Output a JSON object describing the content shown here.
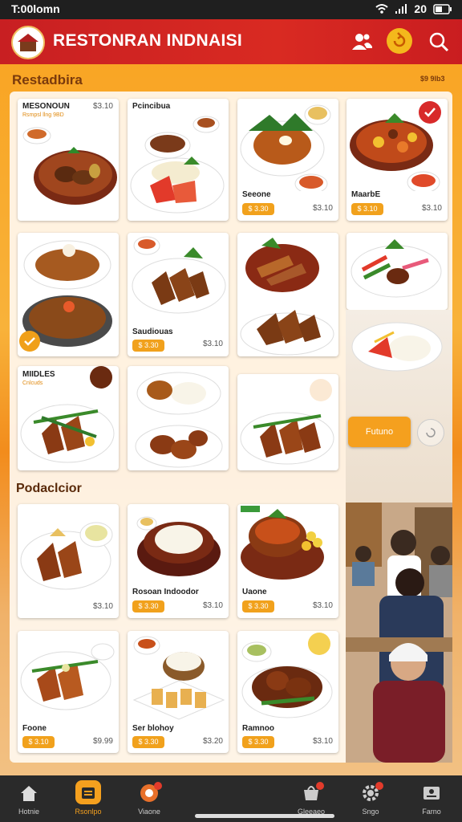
{
  "status_bar": {
    "time": "T:00lomn",
    "battery": "20"
  },
  "app_bar": {
    "title": "RESTONRAN INDNAISI"
  },
  "section1": {
    "title": "Restadbira",
    "right_text": "$9 9lb3"
  },
  "section2": {
    "title": "Podaclcior"
  },
  "cards_row1": [
    {
      "name": "MESONOUN",
      "subtitle": "Rsmpsl llng 9BD",
      "price": "$3.10"
    },
    {
      "name": "Pcincibua",
      "price": ""
    },
    {
      "name": "Seeone",
      "button": "$ 3.30",
      "price": "$3.10"
    },
    {
      "name": "MaarbE",
      "button": "$ 3.10",
      "price": "$3.10"
    }
  ],
  "cards_row2": [
    {
      "name": "",
      "price": ""
    },
    {
      "name": "Saudiouas",
      "button": "$ 3.30",
      "price": "$3.10"
    },
    {
      "name": "",
      "price": ""
    }
  ],
  "cards_row3": [
    {
      "name": "MIIDLES",
      "subtitle": "Cnlcuds"
    },
    {
      "name": ""
    },
    {
      "name": ""
    }
  ],
  "cards_row4": [
    {
      "name": "",
      "price": "$3.10"
    },
    {
      "name": "Rosoan Indoodor",
      "button": "$ 3.30",
      "price": "$3.10"
    },
    {
      "name": "Uaone",
      "button": "$ 3.30",
      "price": "$3.10"
    }
  ],
  "cards_row5": [
    {
      "name": "Foone",
      "button": "$ 3.10",
      "price": "$9.99"
    },
    {
      "name": "Ser blohoy",
      "button": "$ 3.30",
      "price": "$3.20"
    },
    {
      "name": "Ramnoo",
      "button": "$ 3.30",
      "price": "$3.10"
    }
  ],
  "promo": {
    "button_label": "Futuno"
  },
  "bottom_nav": [
    {
      "label": "Hotnie"
    },
    {
      "label": "Rsonlpo"
    },
    {
      "label": "Viaone"
    },
    {
      "label": "Gleeaeo"
    },
    {
      "label": "Sngo"
    },
    {
      "label": "Farno"
    }
  ],
  "colors": {
    "accent": "#f1a11c",
    "brand_red": "#c81f22"
  }
}
